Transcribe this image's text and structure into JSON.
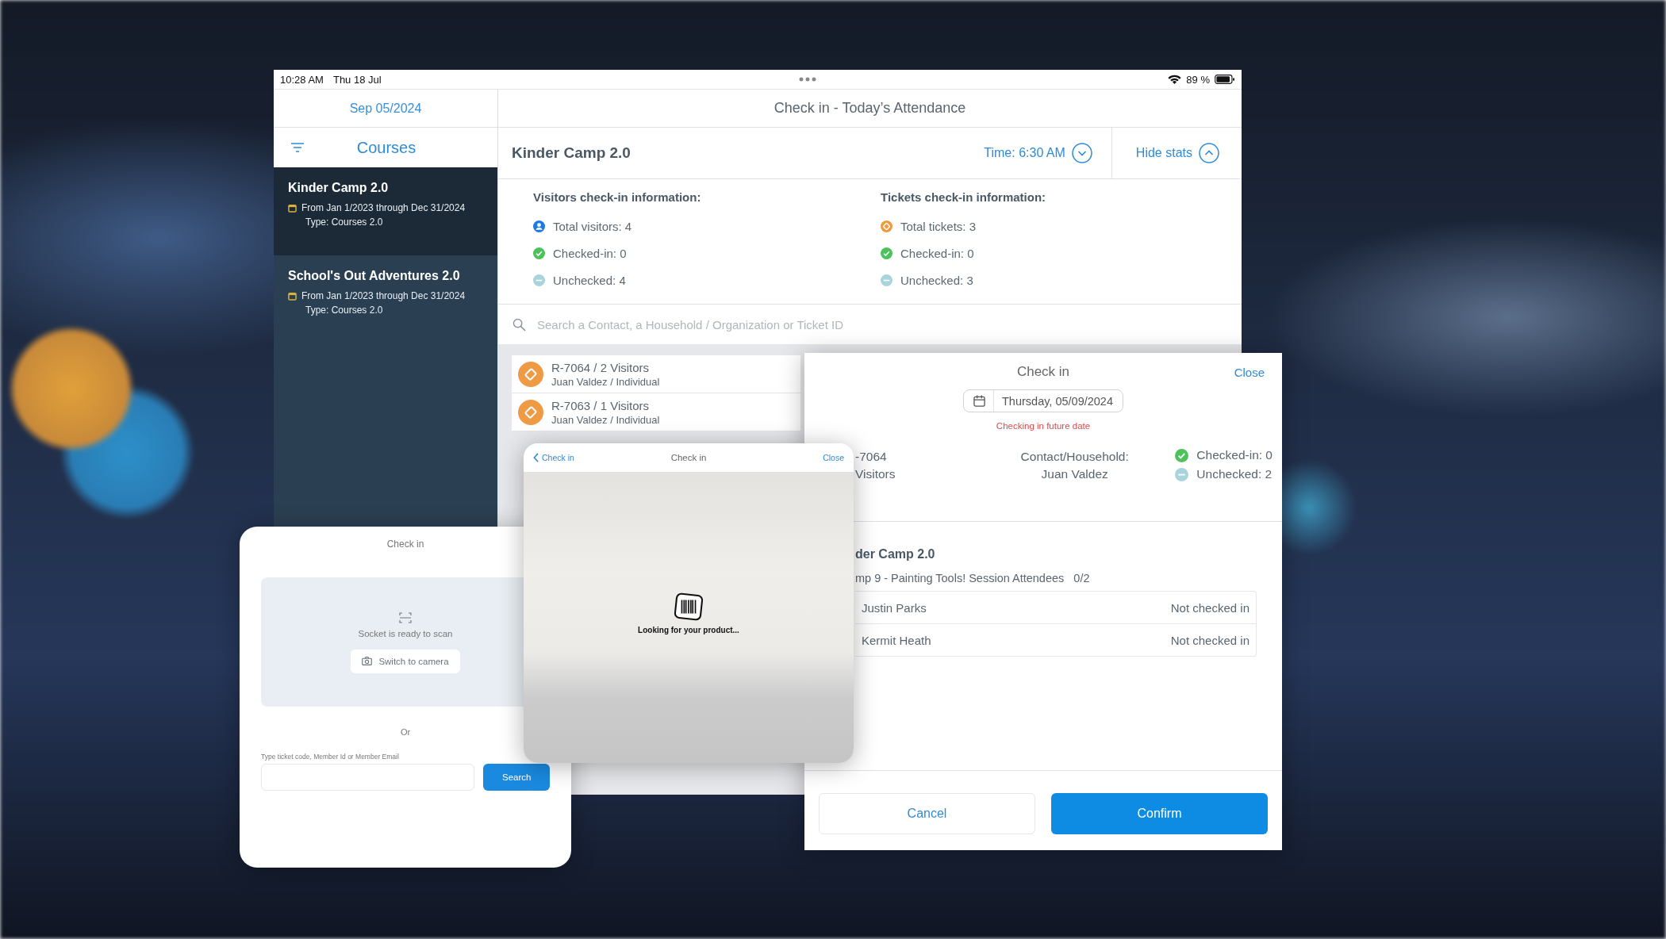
{
  "status_bar": {
    "time": "10:28 AM",
    "date": "Thu 18 Jul",
    "battery": "89 %"
  },
  "sidebar": {
    "date": "Sep 05/2024",
    "title": "Courses",
    "items": [
      {
        "name": "Kinder Camp 2.0",
        "dates": "From Jan 1/2023 through Dec 31/2024",
        "type": "Type: Courses 2.0",
        "selected": true
      },
      {
        "name": "School's Out Adventures 2.0",
        "dates": "From Jan 1/2023 through Dec 31/2024",
        "type": "Type: Courses 2.0",
        "selected": false
      }
    ]
  },
  "main": {
    "title": "Check in - Today’s Attendance",
    "course": "Kinder Camp 2.0",
    "time": "Time: 6:30 AM",
    "hide_stats": "Hide stats",
    "stats": [
      {
        "heading": "Visitors check-in information:",
        "rows": [
          {
            "kind": "visitors",
            "text": "Total visitors: 4"
          },
          {
            "kind": "checked",
            "text": "Checked-in: 0"
          },
          {
            "kind": "unchecked",
            "text": "Unchecked: 4"
          }
        ]
      },
      {
        "heading": "Tickets check-in information:",
        "rows": [
          {
            "kind": "tickets",
            "text": "Total tickets: 3"
          },
          {
            "kind": "checked",
            "text": "Checked-in: 0"
          },
          {
            "kind": "unchecked",
            "text": "Unchecked: 3"
          }
        ]
      }
    ],
    "search": {
      "placeholder": "Search a Contact, a Household / Organization or Ticket ID"
    },
    "tickets": [
      {
        "title": "R-7064 / 2 Visitors",
        "subtitle": "Juan Valdez / Individual"
      },
      {
        "title": "R-7063 / 1 Visitors",
        "subtitle": "Juan Valdez / Individual"
      }
    ]
  },
  "scan_card": {
    "title": "Check in",
    "status": "Socket is ready to scan",
    "camera_button": "Switch to camera",
    "or": "Or",
    "field_label": "Type ticket code, Member Id or Member Email",
    "search_button": "Search"
  },
  "scanner": {
    "back": "Check in",
    "title": "Check in",
    "close": "Close",
    "message": "Looking for your product..."
  },
  "checkin_panel": {
    "title": "Check in",
    "close": "Close",
    "date": "Thursday, 05/09/2024",
    "warning": "Checking in future date",
    "ticket": [
      "-7064",
      "Visitors"
    ],
    "contact_label": "Contact/Household:",
    "contact": "Juan Valdez",
    "stats": [
      {
        "kind": "checked",
        "text": "Checked-in: 0"
      },
      {
        "kind": "unchecked",
        "text": "Unchecked: 2"
      }
    ],
    "course": "der Camp 2.0",
    "session": "mp 9 - Painting Tools! Session Attendees",
    "count": "0/2",
    "attendees": [
      {
        "name": "Justin Parks",
        "status": "Not checked in"
      },
      {
        "name": "Kermit Heath",
        "status": "Not checked in"
      }
    ],
    "cancel": "Cancel",
    "confirm": "Confirm"
  }
}
